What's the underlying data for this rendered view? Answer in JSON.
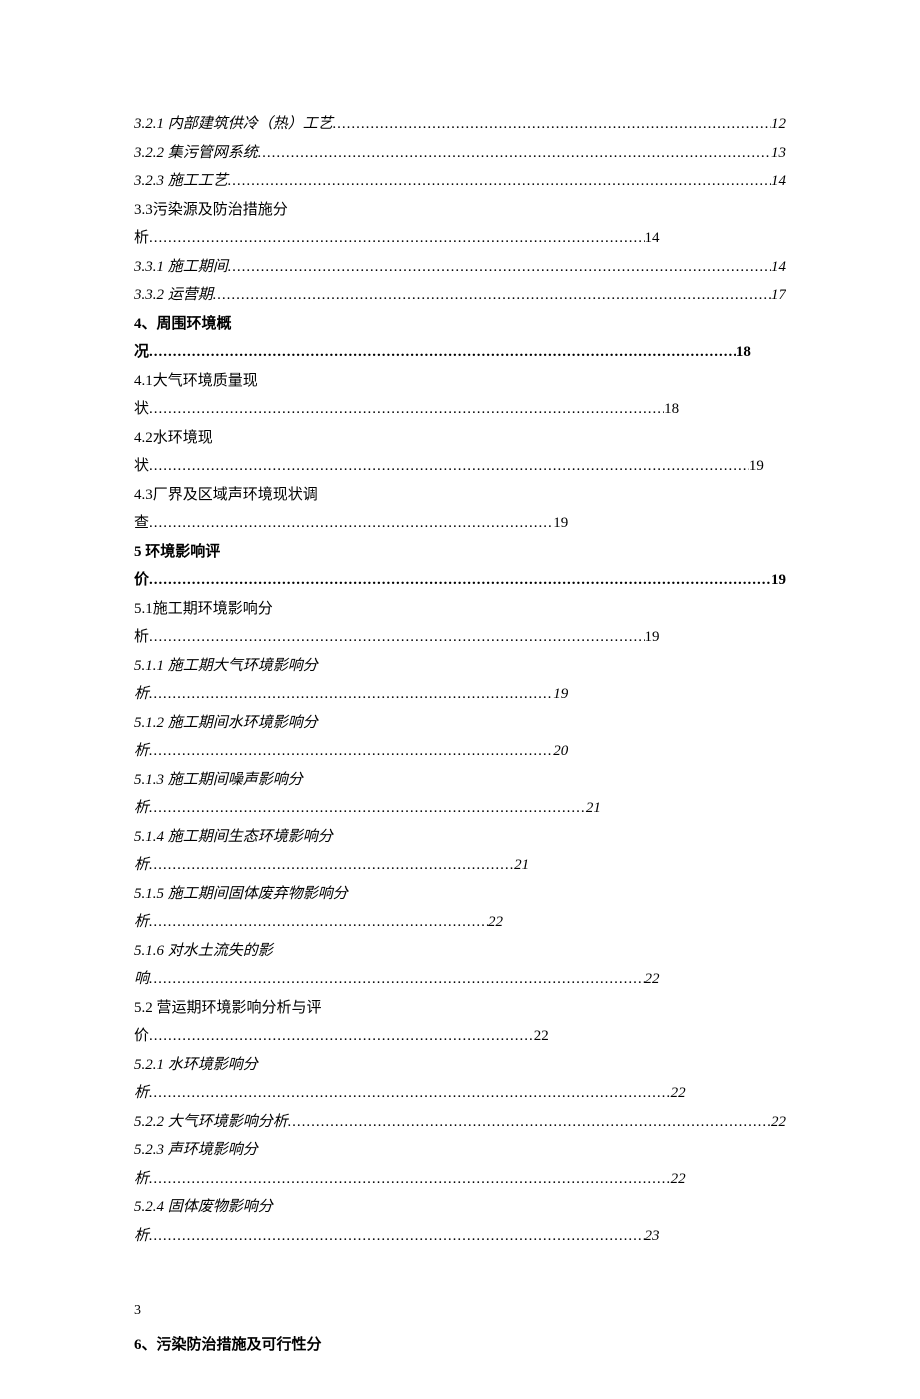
{
  "dots": "...................................................................................................................................................................................................................................................................................................................",
  "entries": [
    {
      "style": "italic",
      "mode": "single",
      "label": "3.2.1  内部建筑供冷（热）工艺",
      "page": "12"
    },
    {
      "style": "italic",
      "mode": "single",
      "label": "3.2.2  集污管网系统",
      "page": "13"
    },
    {
      "style": "italic",
      "mode": "single",
      "label": "3.2.3  施工工艺",
      "page": "14"
    },
    {
      "style": "normal",
      "mode": "wrap",
      "line1": "3.3污染源及防治措施分",
      "tail": "析",
      "page": "14",
      "dotsWidth": "76%"
    },
    {
      "style": "italic",
      "mode": "single",
      "label": "3.3.1  施工期间",
      "page": "14"
    },
    {
      "style": "italic",
      "mode": "single",
      "label": "3.3.2  运营期",
      "page": "17"
    },
    {
      "style": "bold",
      "mode": "wrap",
      "line1": "4、周围环境概",
      "tail": "况",
      "page": "18",
      "dotsWidth": "90%"
    },
    {
      "style": "normal",
      "mode": "wrap",
      "line1": "4.1大气环境质量现",
      "tail": "状",
      "page": "18",
      "dotsWidth": "79%"
    },
    {
      "style": "normal",
      "mode": "wrap",
      "line1": "4.2水环境现",
      "tail": "状",
      "page": "19",
      "dotsWidth": "92%"
    },
    {
      "style": "normal",
      "mode": "wrap",
      "line1": "4.3厂界及区域声环境现状调",
      "tail": "查",
      "page": "19",
      "dotsWidth": "62%"
    },
    {
      "style": "bold",
      "mode": "wrap",
      "line1": "5  环境影响评",
      "tail": "价",
      "page": "19",
      "dotsWidth": "100%"
    },
    {
      "style": "normal",
      "mode": "wrap",
      "line1": "5.1施工期环境影响分",
      "tail": "析",
      "page": "19",
      "dotsWidth": "76%"
    },
    {
      "style": "italic",
      "mode": "wrap",
      "line1": "5.1.1  施工期大气环境影响分",
      "tail": "析",
      "page": "19",
      "dotsWidth": "62%"
    },
    {
      "style": "italic",
      "mode": "wrap",
      "line1": "5.1.2  施工期间水环境影响分",
      "tail": "析",
      "page": "20",
      "dotsWidth": "62%"
    },
    {
      "style": "italic",
      "mode": "wrap",
      "line1": "5.1.3  施工期间噪声影响分",
      "tail": "析",
      "page": "21",
      "dotsWidth": "67%"
    },
    {
      "style": "italic",
      "mode": "wrap",
      "line1": "5.1.4  施工期间生态环境影响分",
      "tail": "析",
      "page": "21",
      "dotsWidth": "56%"
    },
    {
      "style": "italic",
      "mode": "wrap",
      "line1": "5.1.5  施工期间固体废弃物影响分",
      "tail": "析",
      "page": "22",
      "dotsWidth": "52%"
    },
    {
      "style": "italic",
      "mode": "wrap",
      "line1": "5.1.6  对水土流失的影",
      "tail": "响",
      "page": "22",
      "dotsWidth": "76%"
    },
    {
      "style": "normal",
      "mode": "wrap",
      "line1": "5.2  营运期环境影响分析与评",
      "tail": "价",
      "page": "22",
      "dotsWidth": "59%"
    },
    {
      "style": "italic",
      "mode": "wrap",
      "line1": "5.2.1  水环境影响分",
      "tail": "析",
      "page": "22",
      "dotsWidth": "80%"
    },
    {
      "style": "italic",
      "mode": "single",
      "label": "5.2.2  大气环境影响分析",
      "page": "22"
    },
    {
      "style": "italic",
      "mode": "wrap",
      "line1": "5.2.3  声环境影响分",
      "tail": "析",
      "page": "22",
      "dotsWidth": "80%"
    },
    {
      "style": "italic",
      "mode": "wrap",
      "line1": "5.2.4  固体废物影响分",
      "tail": "析",
      "page": "23",
      "dotsWidth": "76%"
    }
  ],
  "footer_page": "3",
  "next_section": "6、污染防治措施及可行性分"
}
